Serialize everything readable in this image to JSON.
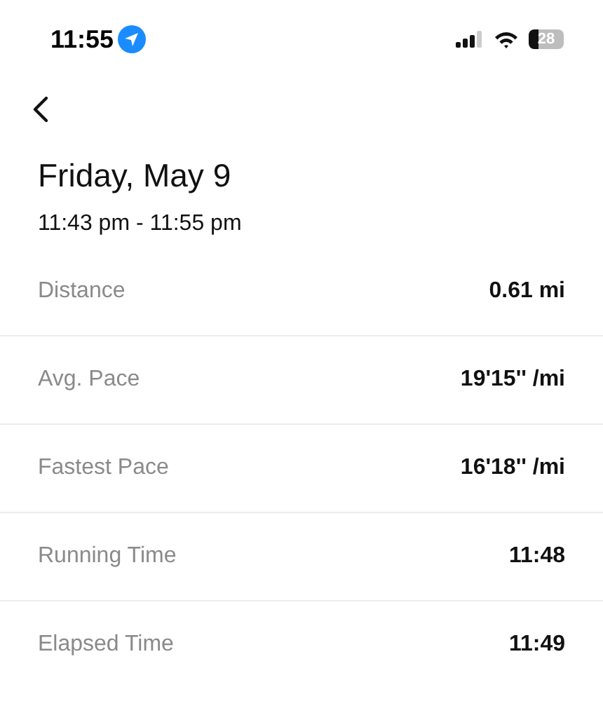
{
  "status_bar": {
    "time": "11:55",
    "battery": "28"
  },
  "title": "Friday, May 9",
  "time_range": "11:43 pm - 11:55 pm",
  "stats": [
    {
      "label": "Distance",
      "value": "0.61 mi"
    },
    {
      "label": "Avg. Pace",
      "value": "19'15'' /mi"
    },
    {
      "label": "Fastest Pace",
      "value": "16'18'' /mi"
    },
    {
      "label": "Running Time",
      "value": "11:48"
    },
    {
      "label": "Elapsed Time",
      "value": "11:49"
    }
  ]
}
